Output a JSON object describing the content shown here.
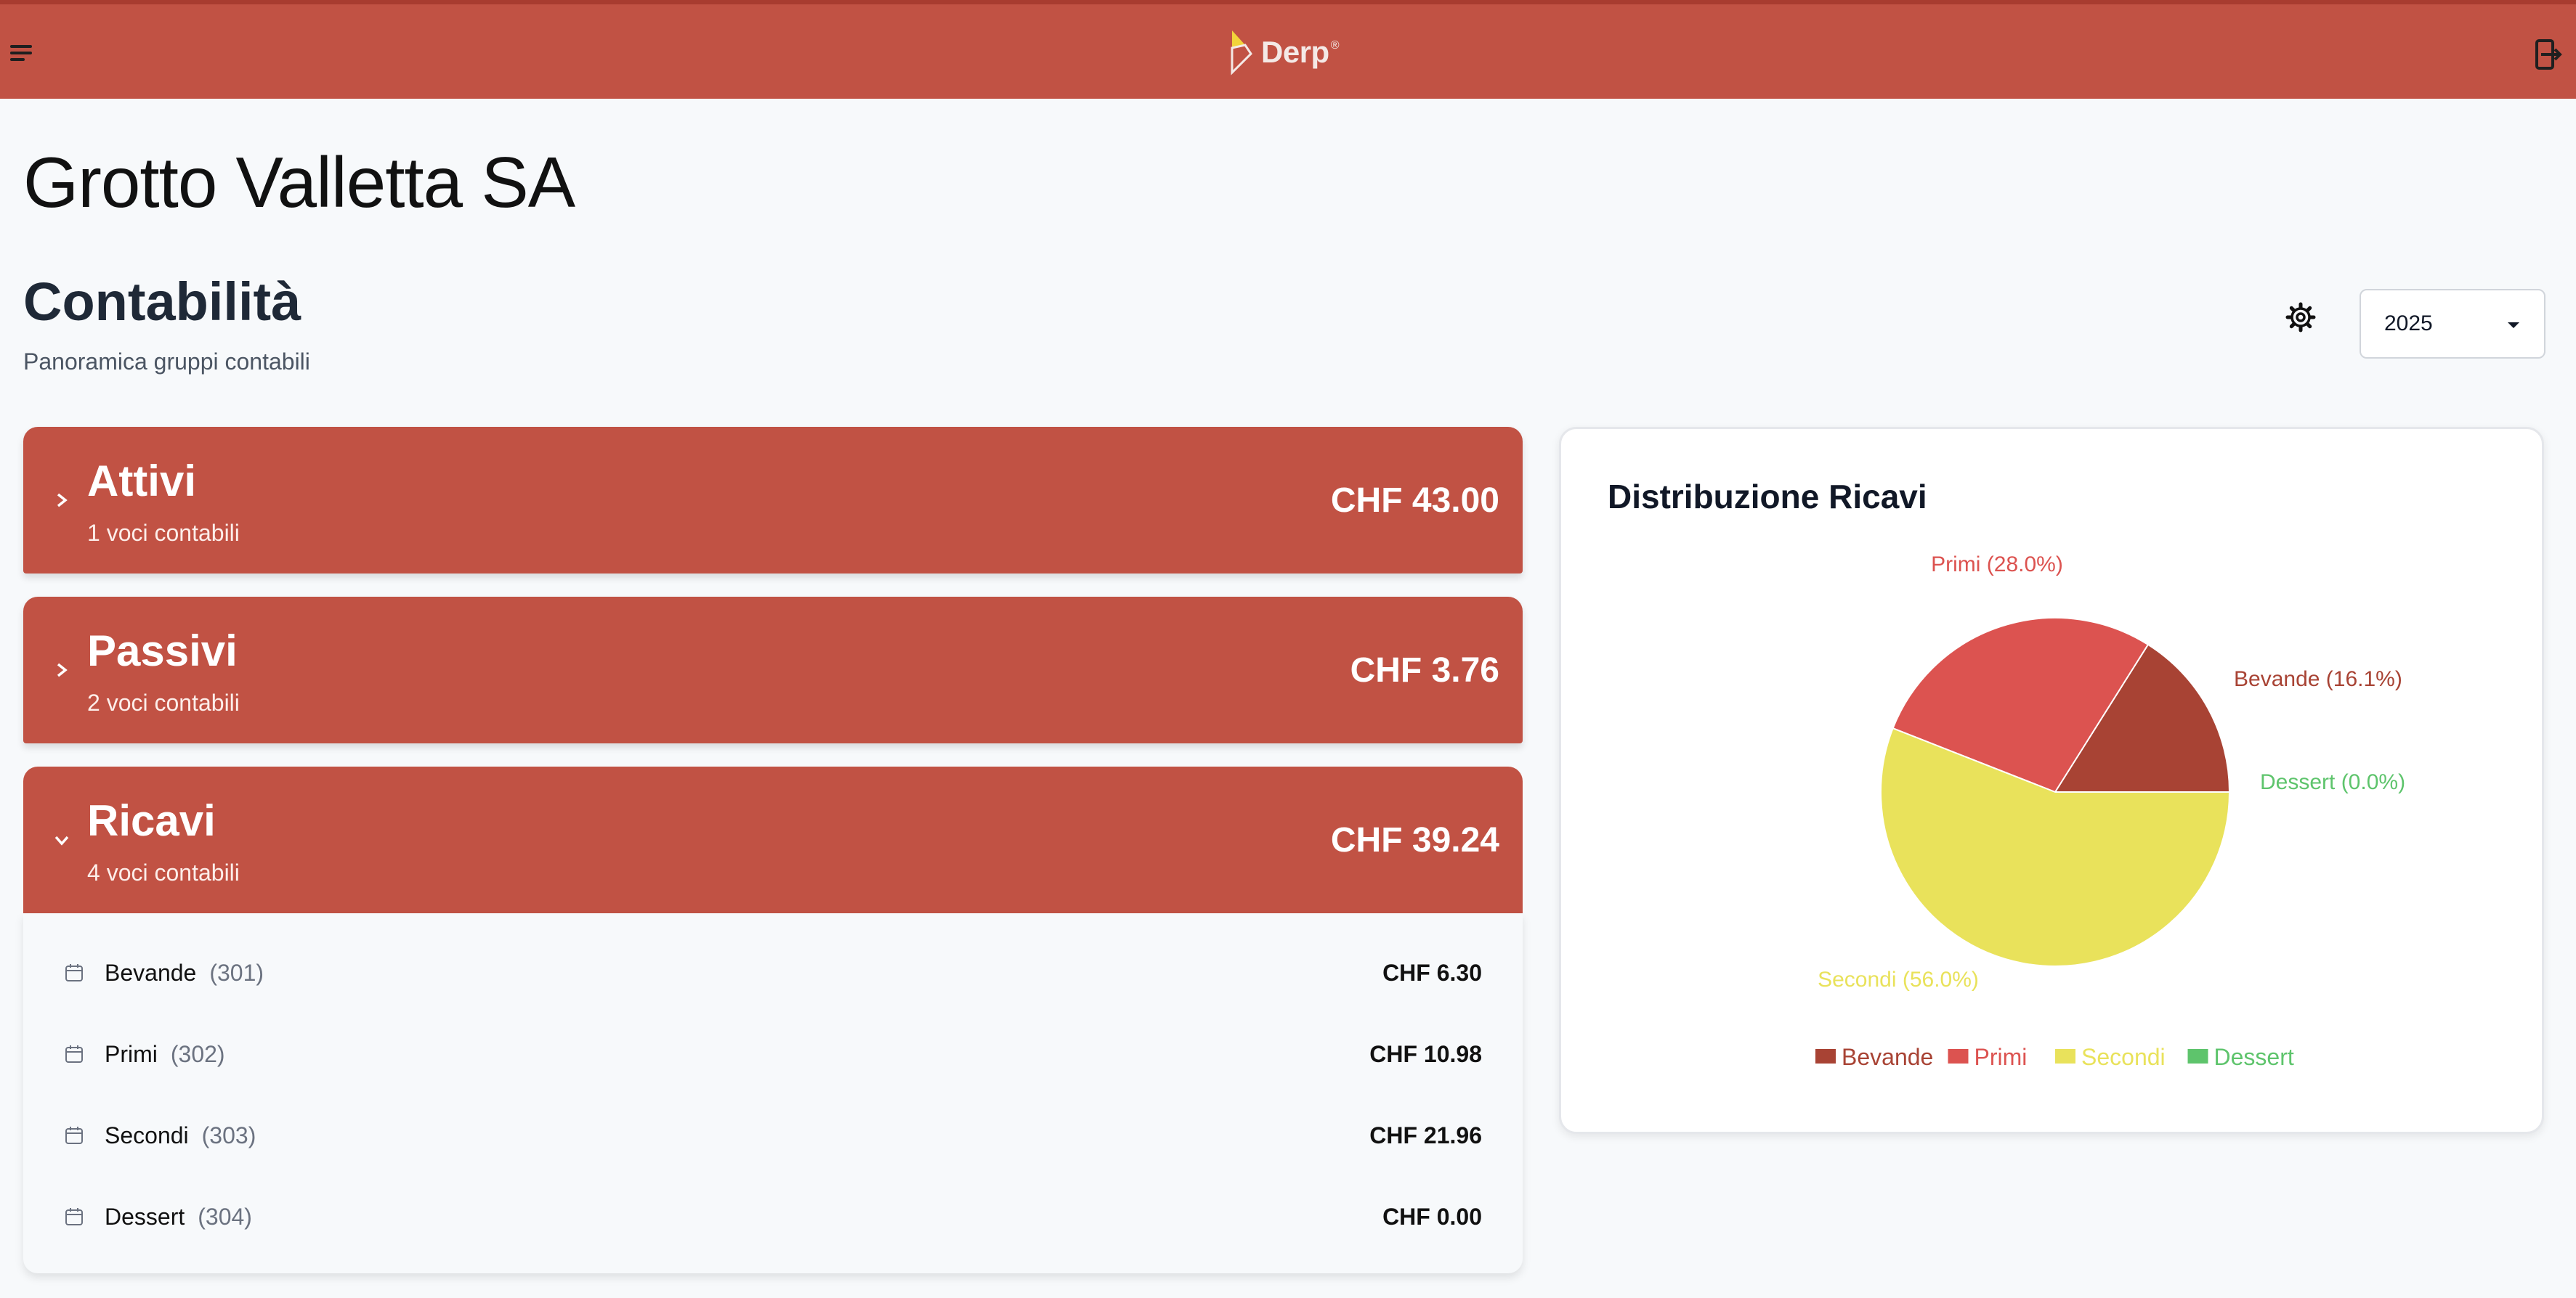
{
  "header": {
    "logo_text": "Derp",
    "logo_mark": "®",
    "menu_icon": "hamburger-menu-icon",
    "logout_icon": "logout-door-icon"
  },
  "page": {
    "company_name": "Grotto Valletta SA",
    "section_title": "Contabilità",
    "section_subtitle": "Panoramica gruppi contabili",
    "settings_icon": "gear-icon",
    "year_selected": "2025"
  },
  "groups": [
    {
      "name": "Attivi",
      "count_label": "1 voci contabili",
      "amount": "CHF 43.00",
      "expanded": false
    },
    {
      "name": "Passivi",
      "count_label": "2 voci contabili",
      "amount": "CHF 3.76",
      "expanded": false
    },
    {
      "name": "Ricavi",
      "count_label": "4 voci contabili",
      "amount": "CHF 39.24",
      "expanded": true
    }
  ],
  "ricavi_items": [
    {
      "name": "Bevande",
      "code": "(301)",
      "amount": "CHF 6.30"
    },
    {
      "name": "Primi",
      "code": "(302)",
      "amount": "CHF 10.98"
    },
    {
      "name": "Secondi",
      "code": "(303)",
      "amount": "CHF 21.96"
    },
    {
      "name": "Dessert",
      "code": "(304)",
      "amount": "CHF 0.00"
    }
  ],
  "colors": {
    "brand": "#c15244",
    "bevande": "#a84334",
    "primi": "#dc5350",
    "secondi": "#e9e25b",
    "dessert": "#5ec46c"
  },
  "chart_data": {
    "type": "pie",
    "title": "Distribuzione Ricavi",
    "categories": [
      "Bevande",
      "Primi",
      "Secondi",
      "Dessert"
    ],
    "values": [
      6.3,
      10.98,
      21.96,
      0.0
    ],
    "labels": [
      "Bevande (16.1%)",
      "Primi (28.0%)",
      "Secondi (56.0%)",
      "Dessert (0.0%)"
    ],
    "colors": [
      "#a84334",
      "#dc5350",
      "#e9e25b",
      "#5ec46c"
    ],
    "legend": "bottom"
  }
}
